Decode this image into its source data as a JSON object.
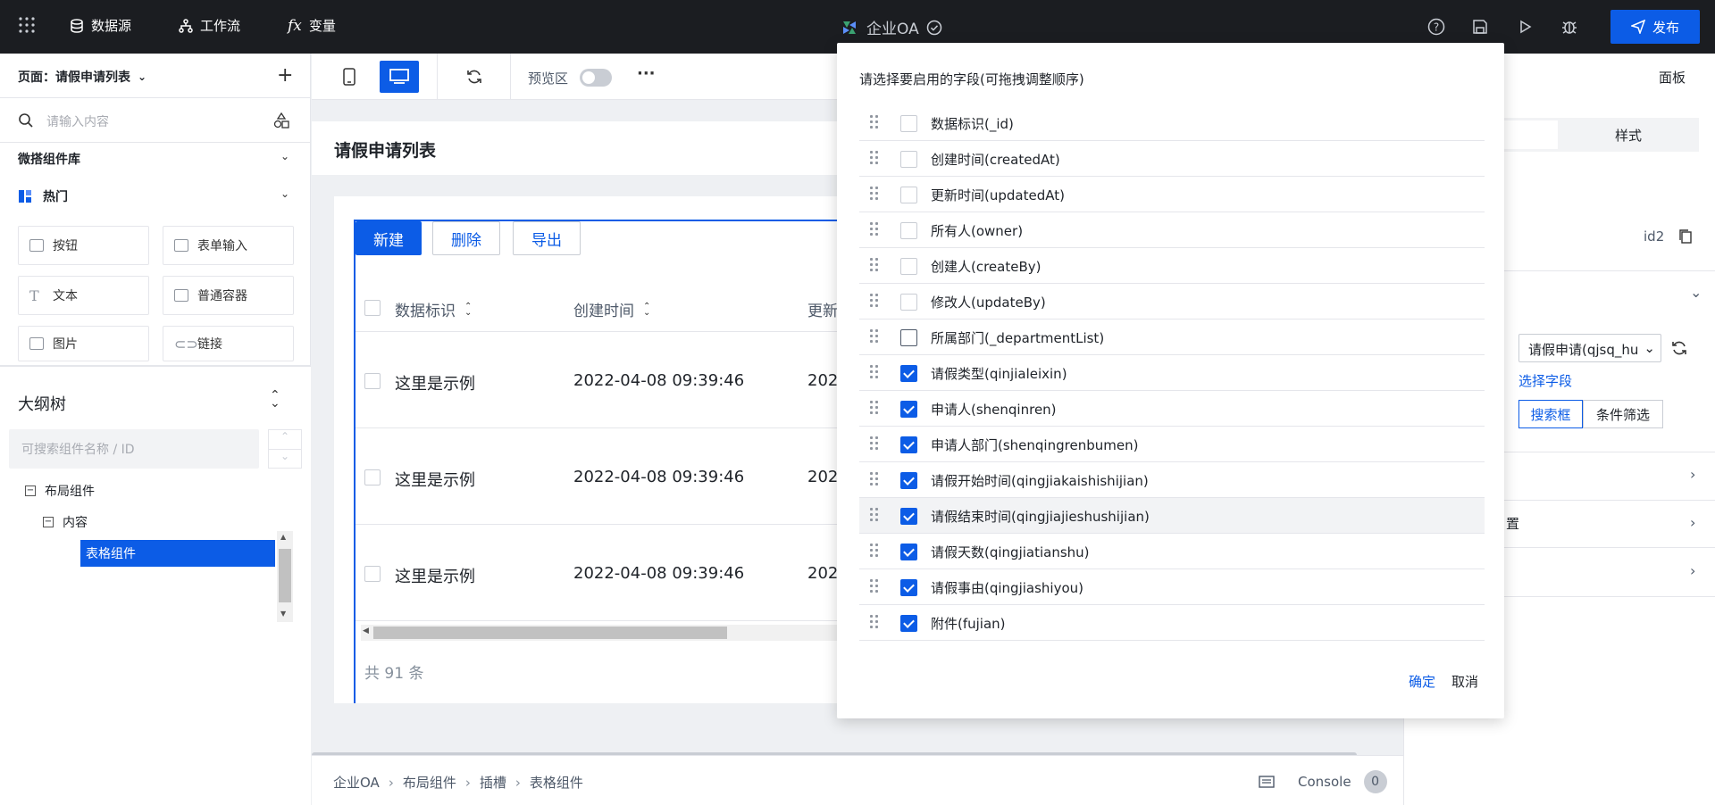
{
  "topbar": {
    "grid_icon": "apps-grid-icon",
    "datasource": "数据源",
    "workflow": "工作流",
    "variables": "变量",
    "app_name": "企业OA",
    "publish": "发布"
  },
  "left": {
    "page_label": "页面：请假申请列表",
    "search_placeholder": "请输入内容",
    "library_title": "微搭组件库",
    "hot_title": "热门",
    "components": [
      "按钮",
      "表单输入",
      "文本",
      "普通容器",
      "图片",
      "链接"
    ],
    "outline_title": "大纲树",
    "tree_search_placeholder": "可搜索组件名称 / ID",
    "tree": {
      "layout": "布局组件",
      "content": "内容",
      "table": "表格组件"
    }
  },
  "toolbar": {
    "preview_label": "预览区",
    "more": "···"
  },
  "canvas": {
    "page_title": "请假申请列表",
    "buttons": {
      "new": "新建",
      "delete": "删除",
      "export": "导出"
    },
    "columns": [
      "数据标识",
      "创建时间",
      "更新"
    ],
    "rows": [
      {
        "id": "这里是示例",
        "created": "2022-04-08 09:39:46",
        "updated": "202"
      },
      {
        "id": "这里是示例",
        "created": "2022-04-08 09:39:46",
        "updated": "202"
      },
      {
        "id": "这里是示例",
        "created": "2022-04-08 09:39:46",
        "updated": "202"
      }
    ],
    "total": "共 91 条"
  },
  "breadcrumb": {
    "items": [
      "企业OA",
      "布局组件",
      "插槽",
      "表格组件"
    ],
    "console": "Console",
    "console_count": "0"
  },
  "right": {
    "panel": "面板",
    "style_tab": "样式",
    "id_value": "id2",
    "datasource_value": "请假申请(qjsq_hu",
    "select_fields": "选择字段",
    "tab_search": "搜索框",
    "tab_filter": "条件筛选",
    "section_partial": "置"
  },
  "dialog": {
    "title": "请选择要启用的字段(可拖拽调整顺序)",
    "fields": [
      {
        "label": "数据标识(_id)",
        "checked": false
      },
      {
        "label": "创建时间(createdAt)",
        "checked": false
      },
      {
        "label": "更新时间(updatedAt)",
        "checked": false
      },
      {
        "label": "所有人(owner)",
        "checked": false
      },
      {
        "label": "创建人(createBy)",
        "checked": false
      },
      {
        "label": "修改人(updateBy)",
        "checked": false
      },
      {
        "label": "所属部门(_departmentList)",
        "checked": false
      },
      {
        "label": "请假类型(qinjialeixin)",
        "checked": true
      },
      {
        "label": "申请人(shenqinren)",
        "checked": true
      },
      {
        "label": "申请人部门(shenqingrenbumen)",
        "checked": true
      },
      {
        "label": "请假开始时间(qingjiakaishishijian)",
        "checked": true
      },
      {
        "label": "请假结束时间(qingjiajieshushijian)",
        "checked": true
      },
      {
        "label": "请假天数(qingjiatianshu)",
        "checked": true
      },
      {
        "label": "请假事由(qingjiashiyou)",
        "checked": true
      },
      {
        "label": "附件(fujian)",
        "checked": true
      }
    ],
    "ok": "确定",
    "cancel": "取消"
  },
  "colors": {
    "accent": "#0c5ce6",
    "topbar_bg": "#1b1d21"
  }
}
